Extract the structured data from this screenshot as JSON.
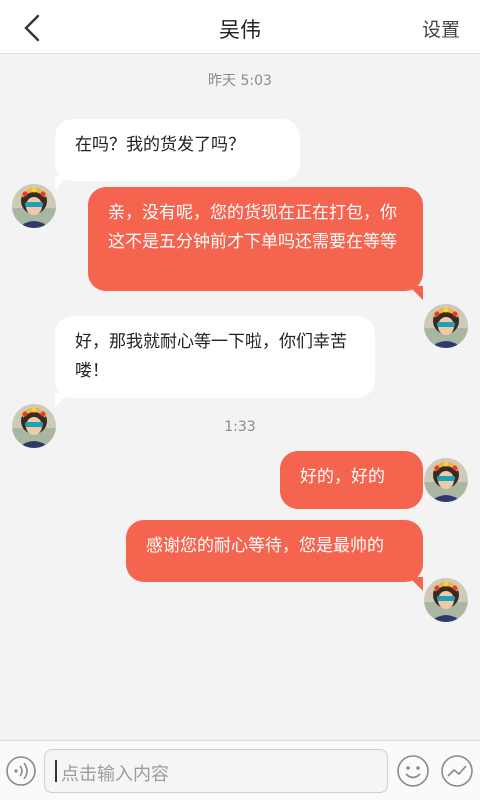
{
  "header": {
    "title": "吴伟",
    "settings_label": "设置"
  },
  "timestamps": [
    "昨天 5:03",
    "1:33"
  ],
  "messages": [
    {
      "side": "left",
      "text": "在吗？我的货发了吗？"
    },
    {
      "side": "right",
      "text": "亲，没有呢，您的货现在正在打包，你这不是五分钟前才下单吗还需要在等等"
    },
    {
      "side": "left",
      "text": "好，那我就耐心等一下啦，你们幸苦喽！"
    },
    {
      "side": "right",
      "text": "好的，好的"
    },
    {
      "side": "right",
      "text": "感谢您的耐心等待，您是最帅的"
    }
  ],
  "input": {
    "placeholder": "点击输入内容"
  },
  "colors": {
    "outgoing_bubble": "#f4644f",
    "incoming_bubble": "#ffffff",
    "background": "#f3f3f3"
  }
}
